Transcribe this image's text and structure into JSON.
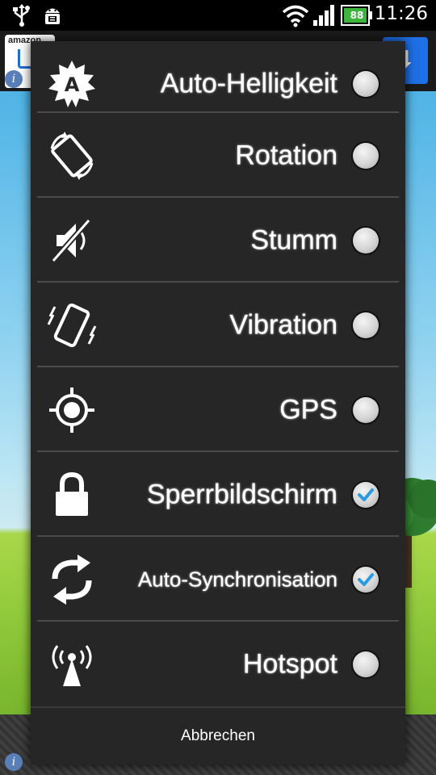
{
  "status_bar": {
    "time": "11:26",
    "battery_level": "88",
    "icons": [
      "usb-icon",
      "android-debug-icon",
      "wifi-icon",
      "signal-icon",
      "battery-icon"
    ]
  },
  "background_app": {
    "ad_logo_text": "amazon",
    "ad_icons": [
      "amazon-cart-icon",
      "info-icon",
      "download-icon"
    ]
  },
  "dialog": {
    "items": [
      {
        "label": "Auto-Helligkeit",
        "icon": "auto-brightness-icon",
        "checked": false
      },
      {
        "label": "Rotation",
        "icon": "rotation-icon",
        "checked": false
      },
      {
        "label": "Stumm",
        "icon": "mute-icon",
        "checked": false
      },
      {
        "label": "Vibration",
        "icon": "vibration-icon",
        "checked": false
      },
      {
        "label": "GPS",
        "icon": "gps-icon",
        "checked": false
      },
      {
        "label": "Sperrbildschirm",
        "icon": "lock-icon",
        "checked": true
      },
      {
        "label": "Auto-Synchronisation",
        "icon": "sync-icon",
        "checked": true
      },
      {
        "label": "Hotspot",
        "icon": "hotspot-icon",
        "checked": false
      }
    ],
    "cancel_label": "Abbrechen"
  },
  "colors": {
    "dialog_bg": "#262626",
    "check_accent": "#2a9be0",
    "text": "#ffffff"
  }
}
